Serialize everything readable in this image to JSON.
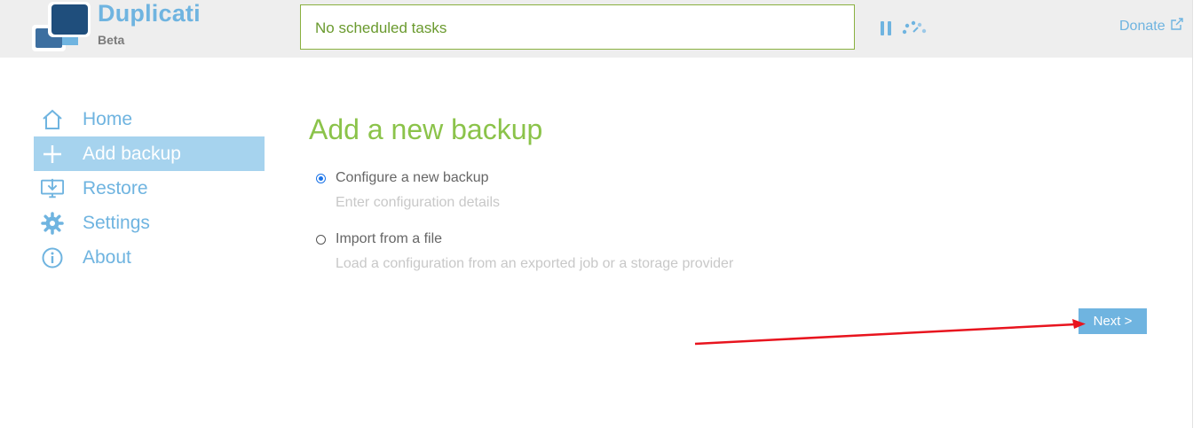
{
  "header": {
    "brand_name": "Duplicati",
    "brand_sub": "Beta",
    "status_text": "No scheduled tasks",
    "donate_label": "Donate",
    "icons": {
      "logo": "duplicati-logo",
      "pause": "pause-icon",
      "throttle": "throttle-icon",
      "external": "external-link-icon"
    }
  },
  "sidebar": {
    "items": [
      {
        "label": "Home",
        "icon": "home-icon",
        "active": false
      },
      {
        "label": "Add backup",
        "icon": "plus-icon",
        "active": true
      },
      {
        "label": "Restore",
        "icon": "restore-icon",
        "active": false
      },
      {
        "label": "Settings",
        "icon": "gear-icon",
        "active": false
      },
      {
        "label": "About",
        "icon": "info-icon",
        "active": false
      }
    ]
  },
  "main": {
    "title": "Add a new backup",
    "options": [
      {
        "label": "Configure a new backup",
        "description": "Enter configuration details",
        "selected": true
      },
      {
        "label": "Import from a file",
        "description": "Load a configuration from an exported job or a storage provider",
        "selected": false
      }
    ],
    "next_label": "Next >"
  },
  "colors": {
    "accent_blue": "#6fb4e0",
    "active_nav_bg": "#a6d3ee",
    "title_green": "#8bc34a",
    "status_border": "#8ab040",
    "annotation_arrow": "#e8141e"
  }
}
